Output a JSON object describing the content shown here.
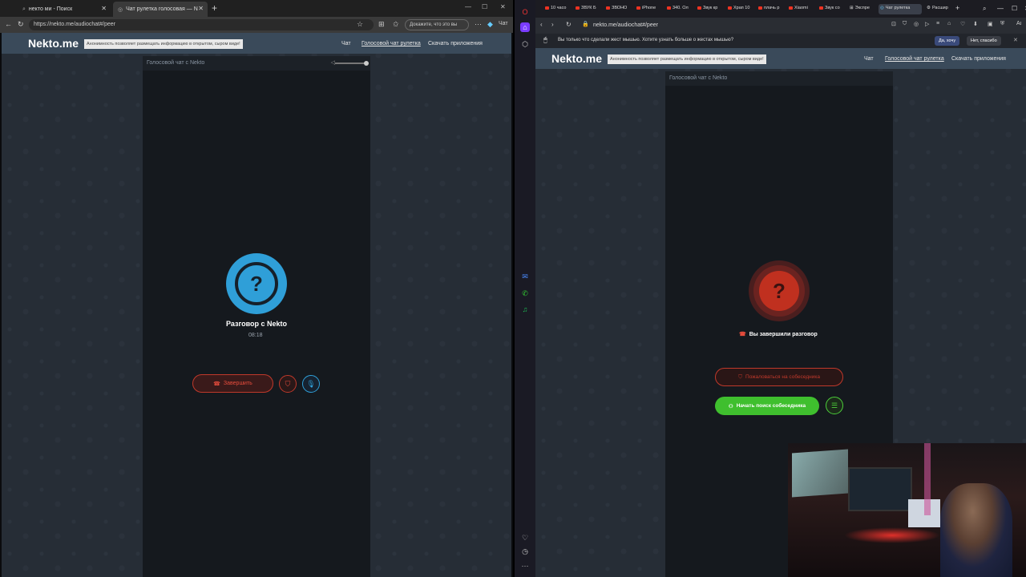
{
  "left_browser": {
    "tabs": [
      {
        "label": "некто ми - Поиск",
        "active": false
      },
      {
        "label": "Чат рулетка голосовая — N",
        "active": true
      }
    ],
    "url": "https://nekto.me/audiochat#/peer",
    "profile_pill": "Докажите, что это вы",
    "copilot_label": "Чат"
  },
  "left_site": {
    "logo": "Nekto.me",
    "notice": "Анонимность позволяет размещать информацию в открытом, сыром виде!",
    "nav": [
      "Чат",
      "Голосовой чат рулетка",
      "Скачать приложения"
    ],
    "column_header": "Голосовой чат с Nekto",
    "icon_text": "?",
    "conversation_title": "Разговор с Nekto",
    "timer": "08:18",
    "end_button": "Завершить"
  },
  "right_browser": {
    "tabs": [
      "10 часо",
      "ЗВУК Б",
      "ЗВОНО",
      "iPhone",
      "340. Ол",
      "Звук кр",
      "Храп 10",
      "плачь р",
      "Xiaomi",
      "Звук со",
      "Экспре",
      "Чат рулетка",
      "Расшир"
    ],
    "active_tab_index": 11,
    "url": "nekto.me/audiochat#/peer",
    "info_bar": "Вы только что сделали жест мышью. Хотите узнать больше о жестах мышью?",
    "info_yes": "Да, хочу",
    "info_no": "Нет, спасибо"
  },
  "right_site": {
    "logo": "Nekto.me",
    "notice": "Анонимность позволяет размещать информацию в открытом, сыром виде!",
    "nav": [
      "Чат",
      "Голосовой чат рулетка",
      "Скачать приложения"
    ],
    "column_header": "Голосовой чат с Nekto",
    "icon_text": "?",
    "ended_text": "Вы завершили разговор",
    "report_button": "Пожаловаться на собеседника",
    "search_button": "Начать поиск собеседника"
  },
  "colors": {
    "accent_blue": "#2f9fd8",
    "accent_red": "#c0392b",
    "accent_green": "#3fbf2e",
    "header_bg": "#3a4a5a"
  }
}
